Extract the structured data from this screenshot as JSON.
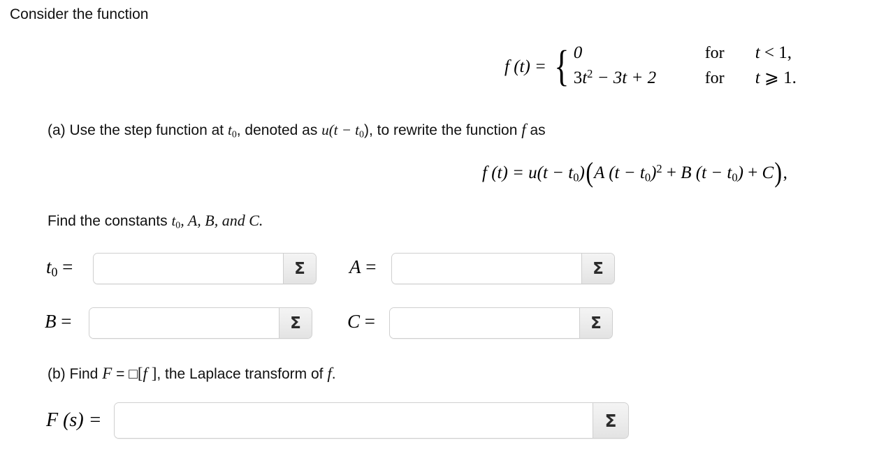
{
  "intro": {
    "text": "Consider the function"
  },
  "piecewise": {
    "lhs": "f (t) =",
    "rows": [
      {
        "case": "0",
        "for": "for",
        "cond_var": "t",
        "cond_rel": "<",
        "cond_val": "1,"
      },
      {
        "case_coef": "3",
        "case_var": "t",
        "case_exp": "2",
        "case_rest": " − 3t + 2",
        "for": "for",
        "cond_var": "t",
        "cond_rel": "⩾",
        "cond_val": "1."
      }
    ],
    "brace": "{"
  },
  "part_a": {
    "prefix": "(a) Use the step function at ",
    "sub_var": "t",
    "sub_idx": "0",
    "mid": ", denoted as ",
    "u_expr": "u(t − t",
    "u_idx": "0",
    "u_close": "), to rewrite the function ",
    "f_sym": "f",
    "suffix": " as"
  },
  "equation_rewrite": {
    "lhs": "f (t) = u(t − t",
    "lhs_idx": "0",
    "lhs_close": ")",
    "paren_open": "(",
    "term_a": "A (t − t",
    "term_a_idx": "0",
    "term_a_close": ")",
    "term_a_exp": "2",
    "plus1": " + ",
    "term_b": "B (t − t",
    "term_b_idx": "0",
    "term_b_close": ")",
    "plus2": " + ",
    "term_c": "C",
    "paren_close": ")",
    "comma": ","
  },
  "find_constants": {
    "prefix": "Find the constants ",
    "t_var": "t",
    "t_idx": "0",
    "rest": ", A, B, and C."
  },
  "answers": [
    {
      "label_var": "t",
      "label_idx": "0",
      "label_eq": " =",
      "value": "",
      "placeholder": "",
      "sigma": "Σ"
    },
    {
      "label_var": "A",
      "label_idx": "",
      "label_eq": " =",
      "value": "",
      "placeholder": "",
      "sigma": "Σ"
    },
    {
      "label_var": "B",
      "label_idx": "",
      "label_eq": " =",
      "value": "",
      "placeholder": "",
      "sigma": "Σ"
    },
    {
      "label_var": "C",
      "label_idx": "",
      "label_eq": " =",
      "value": "",
      "placeholder": "",
      "sigma": "Σ"
    }
  ],
  "part_b": {
    "prefix": "(b) Find ",
    "f_cap": "F",
    "eq": " = ",
    "tofu": "□",
    "bracket_open": "[",
    "f_sym": "f",
    "bracket_close": " ]",
    "suffix": ", the Laplace transform of ",
    "f_sym2": "f",
    "period": "."
  },
  "final_answer": {
    "label": "F (s) =",
    "value": "",
    "placeholder": "",
    "sigma": "Σ"
  },
  "colors": {
    "page_background": "#ffffff",
    "text": "#111111",
    "field_border": "#cfcfcf",
    "sigma_button": "#ececec",
    "sigma_glyph": "#2b2b2b"
  }
}
